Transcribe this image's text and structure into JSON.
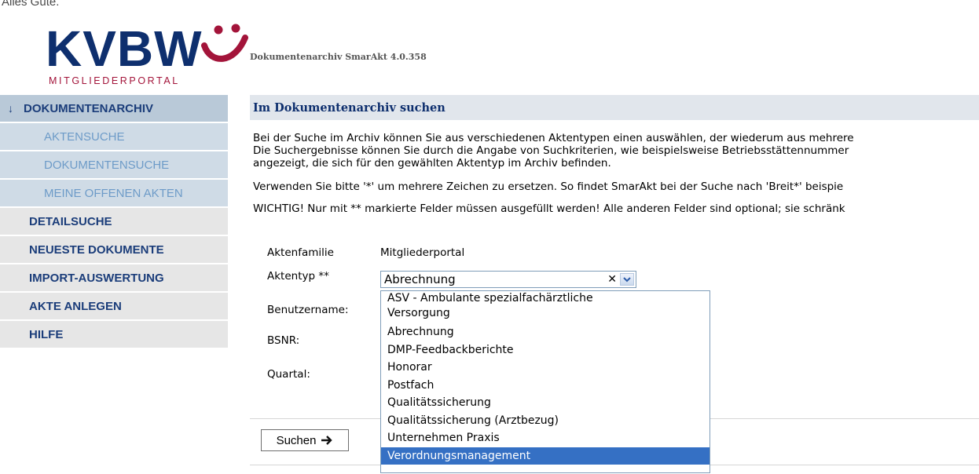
{
  "header": {
    "tagline": "Alles Gute.",
    "logo_text": "KVBW",
    "logo_subtitle": "MITGLIEDERPORTAL",
    "app_version": "Dokumentenarchiv SmarAkt 4.0.358"
  },
  "sidebar": {
    "top_item": "DOKUMENTENARCHIV",
    "sub_items": [
      "AKTENSUCHE",
      "DOKUMENTENSUCHE",
      "MEINE OFFENEN AKTEN"
    ],
    "items": [
      "DETAILSUCHE",
      "NEUESTE DOKUMENTE",
      "IMPORT-AUSWERTUNG",
      "AKTE ANLEGEN",
      "HILFE"
    ]
  },
  "main": {
    "title": "Im Dokumentenarchiv suchen",
    "intro_lines": [
      "Bei der Suche im Archiv können Sie aus verschiedenen Aktentypen einen auswählen, der wiederum aus mehrere",
      "Die Suchergebnisse können Sie durch die Angabe von Suchkriterien, wie beispielsweise Betriebsstättennummer",
      "angezeigt, die sich für den gewählten Aktentyp im Archiv befinden."
    ],
    "wildcard_hint": "Verwenden Sie bitte '*' um mehrere Zeichen zu ersetzen. So findet SmarAkt bei der Suche nach 'Breit*' beispie",
    "important_hint": "WICHTIG! Nur mit ** markierte Felder müssen ausgefüllt werden! Alle anderen Felder sind optional; sie schränk",
    "form": {
      "aktenfamilie_label": "Aktenfamilie",
      "aktenfamilie_value": "Mitgliederportal",
      "aktentyp_label": "Aktentyp **",
      "aktentyp_value": "Abrechnung",
      "benutzername_label": "Benutzername:",
      "bsnr_label": "BSNR:",
      "quartal_label": "Quartal:"
    },
    "dropdown_options": [
      "ASV - Ambulante spezialfachärztliche",
      "Versorgung",
      "Abrechnung",
      "DMP-Feedbackberichte",
      "Honorar",
      "Postfach",
      "Qualitätssicherung",
      "Qualitätssicherung (Arztbezug)",
      "Unternehmen Praxis",
      "Verordnungsmanagement"
    ],
    "selected_option_index": 9,
    "search_button": "Suchen",
    "icons": {
      "nav_arrow": "arrow-down-icon",
      "clear": "clear-x-icon",
      "dropdown": "chevron-down-icon",
      "search_arrow": "arrow-right-icon"
    },
    "colors": {
      "brand_blue": "#0e2f6e",
      "brand_red": "#a3143a",
      "selection": "#3570c4"
    }
  }
}
